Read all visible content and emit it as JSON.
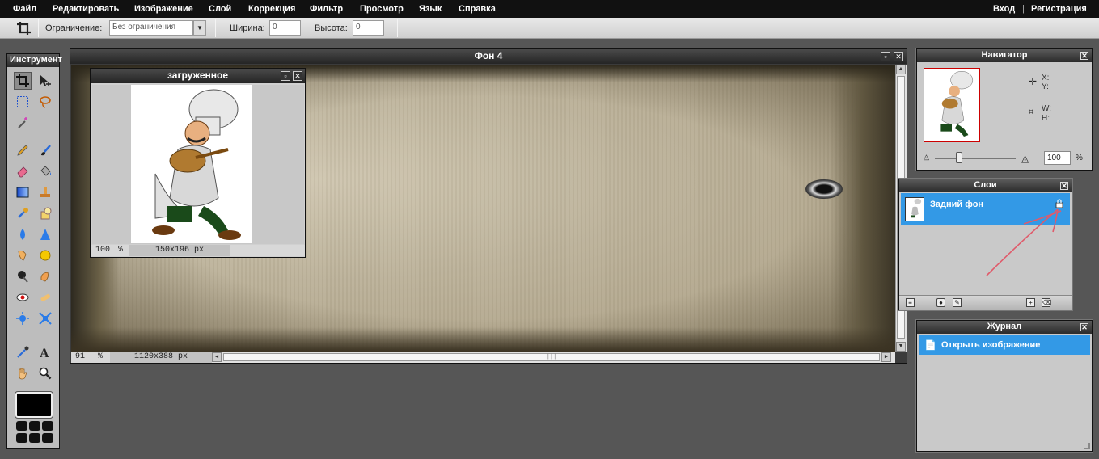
{
  "menu": {
    "items": [
      "Файл",
      "Редактировать",
      "Изображение",
      "Слой",
      "Коррекция",
      "Фильтр",
      "Просмотр",
      "Язык",
      "Справка"
    ],
    "login": "Вход",
    "separator": "|",
    "register": "Регистрация"
  },
  "options": {
    "constraint_label": "Ограничение:",
    "constraint_value": "Без ограничения",
    "width_label": "Ширина:",
    "width_value": "0",
    "height_label": "Высота:",
    "height_value": "0"
  },
  "tools": {
    "title": "Инструмент",
    "icons": [
      "crop-icon",
      "move-icon",
      "marquee-icon",
      "lasso-icon",
      "magic-wand-icon",
      "pencil-icon",
      "brush-icon",
      "eraser-icon",
      "bucket-icon",
      "gradient-icon",
      "stamp-icon",
      "color-replace-icon",
      "drawing-icon",
      "blur-icon",
      "sharpen-icon",
      "smudge-icon",
      "sponge-icon",
      "dodge-icon",
      "burn-icon",
      "red-eye-icon",
      "spot-heal-icon",
      "bloat-icon",
      "pinch-icon",
      "color-picker-icon",
      "text-icon",
      "hand-icon",
      "zoom-icon"
    ]
  },
  "main_doc": {
    "title": "Фон 4",
    "zoom": "91",
    "zoom_unit": "%",
    "size": "1120x388 px"
  },
  "loaded_doc": {
    "title": "загруженное",
    "zoom": "100",
    "zoom_unit": "%",
    "size": "150x196 px"
  },
  "navigator": {
    "title": "Навигатор",
    "x_label": "X:",
    "y_label": "Y:",
    "w_label": "W:",
    "h_label": "H:",
    "zoom_value": "100",
    "zoom_unit": "%",
    "zoom_level": 0.12
  },
  "layers": {
    "title": "Слои",
    "items": [
      {
        "name": "Задний фон",
        "locked": true,
        "selected": true
      }
    ]
  },
  "history": {
    "title": "Журнал",
    "items": [
      {
        "label": "Открыть изображение",
        "selected": true
      }
    ]
  },
  "colors": {
    "accent": "#3399e6",
    "foreground": "#000000"
  }
}
